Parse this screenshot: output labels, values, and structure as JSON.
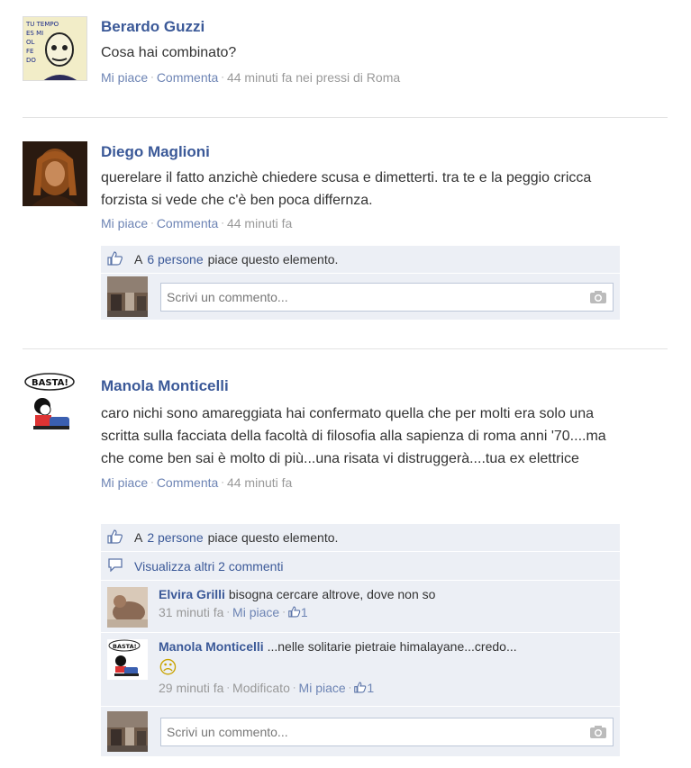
{
  "posts": [
    {
      "author": "Berardo Guzzi",
      "text": "Cosa hai combinato?",
      "like_label": "Mi piace",
      "comment_label": "Commenta",
      "time": "44 minuti fa nei pressi di Roma",
      "avatar_text": [
        "TU TEMPO",
        "ES MI",
        "OL",
        "FE",
        "DO"
      ]
    },
    {
      "author": "Diego Maglioni",
      "text": "querelare il fatto anzichè chiedere scusa e dimetterti. tra te e la peggio cricca forzista si vede che c'è ben poca differnza.",
      "like_label": "Mi piace",
      "comment_label": "Commenta",
      "time": "44 minuti fa",
      "likes_prefix": "A",
      "likes_people": "6 persone",
      "likes_suffix": "piace questo elemento.",
      "comment_placeholder": "Scrivi un commento..."
    },
    {
      "author": "Manola Monticelli",
      "text": "caro nichi sono amareggiata hai confermato quella che per molti era solo una scritta sulla facciata della facoltà di filosofia alla sapienza di roma anni '70....ma che come ben sai è molto di più...una risata vi distruggerà....tua ex elettrice",
      "like_label": "Mi piace",
      "comment_label": "Commenta",
      "time": "44 minuti fa",
      "avatar_text": "BASTA!",
      "likes_prefix": "A",
      "likes_people": "2 persone",
      "likes_suffix": "piace questo elemento.",
      "view_more": "Visualizza altri 2 commenti",
      "comments": [
        {
          "author": "Elvira Grilli",
          "text": "bisogna cercare altrove, dove non so",
          "time": "31 minuti fa",
          "like_label": "Mi piace",
          "like_count": "1"
        },
        {
          "author": "Manola Monticelli",
          "text": "...nelle solitarie pietraie himalayane...credo...",
          "emoticon": "☹",
          "time": "29 minuti fa",
          "edited": "Modificato",
          "like_label": "Mi piace",
          "like_count": "1",
          "avatar_text": "BASTA!"
        }
      ],
      "comment_placeholder": "Scrivi un commento..."
    }
  ],
  "colors": {
    "link": "#3b5998",
    "meta": "#999999",
    "ufi_bg": "#eceff5"
  }
}
